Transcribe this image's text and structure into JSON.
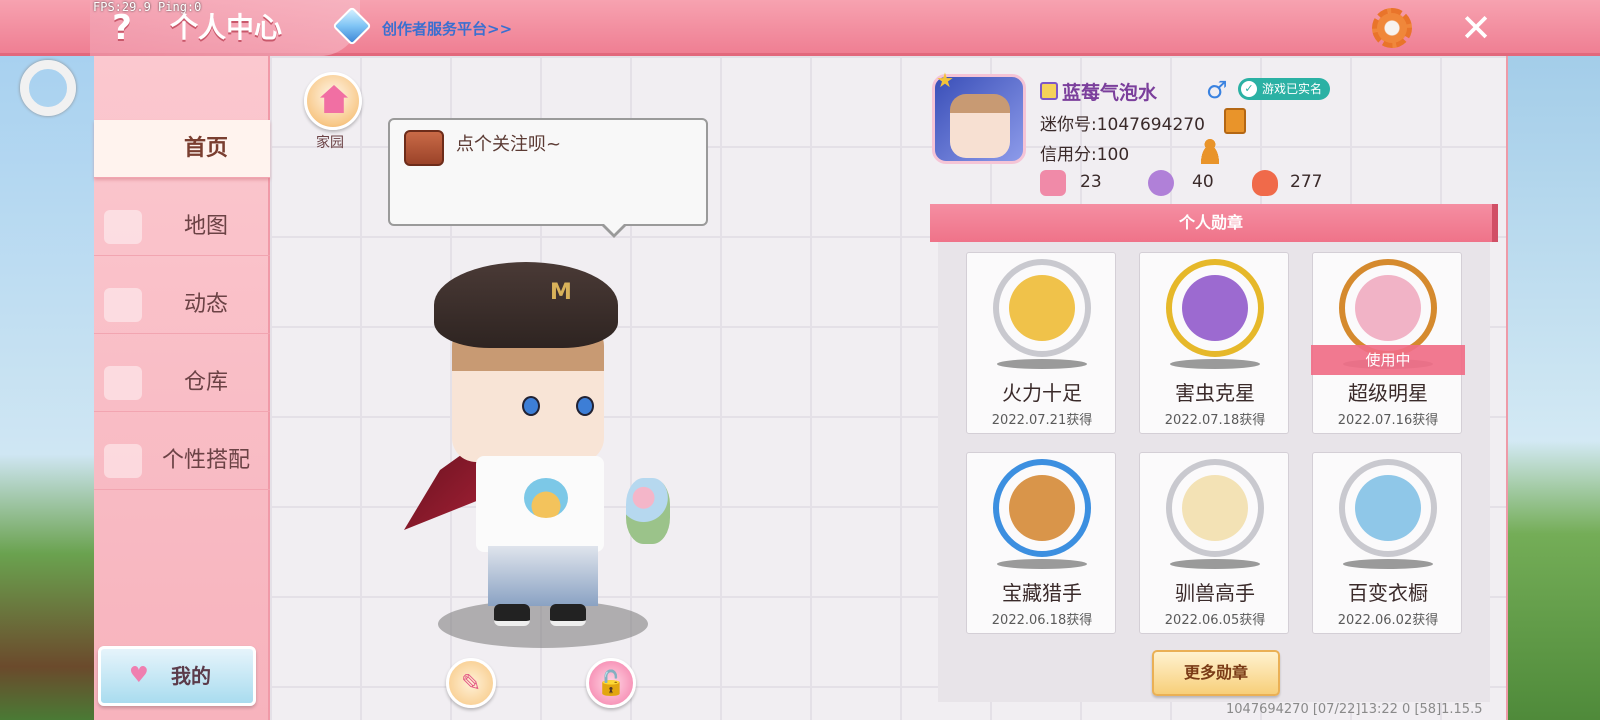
{
  "header": {
    "fps_text": "FPS:29.9  Ping:0",
    "help_glyph": "?",
    "title": "个人中心",
    "creator_link": "创作者服务平台>>",
    "close_glyph": "✕"
  },
  "sidebar": {
    "items": [
      {
        "label": "首页",
        "active": true
      },
      {
        "label": "地图"
      },
      {
        "label": "动态"
      },
      {
        "label": "仓库"
      },
      {
        "label": "个性搭配"
      }
    ],
    "my_button": "我的",
    "heart_glyph": "♥"
  },
  "home": {
    "label": "家园"
  },
  "bubble": {
    "text": "点个关注呗~"
  },
  "profile": {
    "nickname": "蓝莓气泡水",
    "gender_glyph": "♂",
    "verified": "游戏已实名",
    "verified_mark": "✓",
    "mini_id": "迷你号:1047694270",
    "credit": "信用分:100",
    "stats": [
      {
        "icon": "plus-card-icon",
        "value": "23",
        "color": "#f08aa8"
      },
      {
        "icon": "cheer-icon",
        "value": "40",
        "color": "#b080d8"
      },
      {
        "icon": "flame-icon",
        "value": "277",
        "color": "#f06a4a"
      }
    ]
  },
  "badges": {
    "header": "个人勋章",
    "items": [
      {
        "name": "火力十足",
        "date": "2022.07.21获得",
        "frame": "#c9c9cf",
        "inner": "#f0c24a",
        "in_use": false
      },
      {
        "name": "害虫克星",
        "date": "2022.07.18获得",
        "frame": "#e6b82a",
        "inner": "#9c6ad0",
        "in_use": false
      },
      {
        "name": "超级明星",
        "date": "2022.07.16获得",
        "frame": "#d58a2e",
        "inner": "#f1b3c6",
        "in_use": true
      },
      {
        "name": "宝藏猎手",
        "date": "2022.06.18获得",
        "frame": "#3c8fe0",
        "inner": "#d9954a",
        "in_use": false
      },
      {
        "name": "驯兽高手",
        "date": "2022.06.05获得",
        "frame": "#c9c9cf",
        "inner": "#f3e2b5",
        "in_use": false
      },
      {
        "name": "百变衣橱",
        "date": "2022.06.02获得",
        "frame": "#c9c9cf",
        "inner": "#8fc7e8",
        "in_use": false
      }
    ],
    "in_use_label": "使用中",
    "more_button": "更多勋章"
  },
  "character": {
    "hat_letter": "M"
  },
  "buttons": {
    "edit_glyph": "✎",
    "lock_glyph": "🔓"
  },
  "footer": {
    "info": "1047694270    [07/22]13:22 0  [58]1.15.5"
  }
}
